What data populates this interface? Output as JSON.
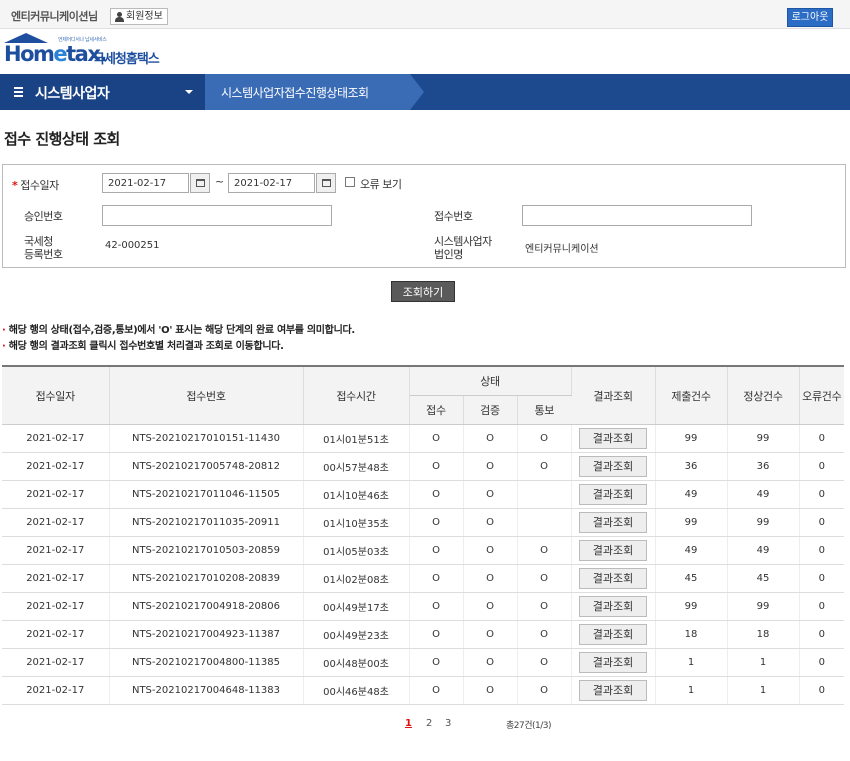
{
  "header": {
    "user_name": "엔티커뮤니케이션님",
    "member_info_label": "회원정보",
    "logout_label": "로그아웃"
  },
  "logo": {
    "small_text": "언제어디서나 납세서비스",
    "brand_home": "Hom",
    "brand_e": "e",
    "brand_tax": "tax.",
    "brand_ko": "국세청홈택스"
  },
  "nav": {
    "menu_title": "시스템사업자",
    "breadcrumb": "시스템사업자접수진행상태조회"
  },
  "page": {
    "title": "접수 진행상태 조회"
  },
  "search": {
    "required_mark": "*",
    "receipt_date_label": "접수일자",
    "date_from": "2021-02-17",
    "date_to": "2021-02-17",
    "tilde": "~",
    "error_view_label": "오류 보기",
    "approval_no_label": "승인번호",
    "receipt_no_label": "접수번호",
    "nts_reg_label_1": "국세청",
    "nts_reg_label_2": "등록번호",
    "nts_reg_value": "42-000251",
    "corp_label_1": "시스템사업자",
    "corp_label_2": "법인명",
    "corp_value": "엔티커뮤니케이션",
    "search_button": "조회하기"
  },
  "notes": [
    "해당 행의 상태(접수,검증,통보)에서 'O' 표시는 해당 단계의 완료 여부를 의미합니다.",
    "해당 행의 결과조회 클릭시 접수번호별 처리결과 조회로 이동합니다."
  ],
  "note_bullet": "·",
  "table": {
    "headers": {
      "date": "접수일자",
      "receipt_no": "접수번호",
      "time": "접수시간",
      "status": "상태",
      "status_receipt": "접수",
      "status_verify": "검증",
      "status_notify": "통보",
      "result": "결과조회",
      "submitted": "제출건수",
      "normal": "정상건수",
      "error": "오류건수"
    },
    "result_button_label": "결과조회",
    "rows": [
      {
        "date": "2021-02-17",
        "no": "NTS-20210217010151-11430",
        "time": "01시01분51초",
        "s1": "O",
        "s2": "O",
        "s3": "O",
        "submitted": "99",
        "normal": "99",
        "error": "0"
      },
      {
        "date": "2021-02-17",
        "no": "NTS-20210217005748-20812",
        "time": "00시57분48초",
        "s1": "O",
        "s2": "O",
        "s3": "O",
        "submitted": "36",
        "normal": "36",
        "error": "0"
      },
      {
        "date": "2021-02-17",
        "no": "NTS-20210217011046-11505",
        "time": "01시10분46초",
        "s1": "O",
        "s2": "O",
        "s3": "",
        "submitted": "49",
        "normal": "49",
        "error": "0"
      },
      {
        "date": "2021-02-17",
        "no": "NTS-20210217011035-20911",
        "time": "01시10분35초",
        "s1": "O",
        "s2": "O",
        "s3": "",
        "submitted": "99",
        "normal": "99",
        "error": "0"
      },
      {
        "date": "2021-02-17",
        "no": "NTS-20210217010503-20859",
        "time": "01시05분03초",
        "s1": "O",
        "s2": "O",
        "s3": "O",
        "submitted": "49",
        "normal": "49",
        "error": "0"
      },
      {
        "date": "2021-02-17",
        "no": "NTS-20210217010208-20839",
        "time": "01시02분08초",
        "s1": "O",
        "s2": "O",
        "s3": "O",
        "submitted": "45",
        "normal": "45",
        "error": "0"
      },
      {
        "date": "2021-02-17",
        "no": "NTS-20210217004918-20806",
        "time": "00시49분17초",
        "s1": "O",
        "s2": "O",
        "s3": "O",
        "submitted": "99",
        "normal": "99",
        "error": "0"
      },
      {
        "date": "2021-02-17",
        "no": "NTS-20210217004923-11387",
        "time": "00시49분23초",
        "s1": "O",
        "s2": "O",
        "s3": "O",
        "submitted": "18",
        "normal": "18",
        "error": "0"
      },
      {
        "date": "2021-02-17",
        "no": "NTS-20210217004800-11385",
        "time": "00시48분00초",
        "s1": "O",
        "s2": "O",
        "s3": "O",
        "submitted": "1",
        "normal": "1",
        "error": "0"
      },
      {
        "date": "2021-02-17",
        "no": "NTS-20210217004648-11383",
        "time": "00시46분48초",
        "s1": "O",
        "s2": "O",
        "s3": "O",
        "submitted": "1",
        "normal": "1",
        "error": "0"
      }
    ]
  },
  "pagination": {
    "pages": [
      "1",
      "2",
      "3"
    ],
    "total": "총27건(1/3)"
  },
  "colors": {
    "nav_bg": "#1d4a8e",
    "crumb_bg": "#3a6cb6",
    "logout_bg": "#2b6cc4",
    "required": "#d11111"
  }
}
